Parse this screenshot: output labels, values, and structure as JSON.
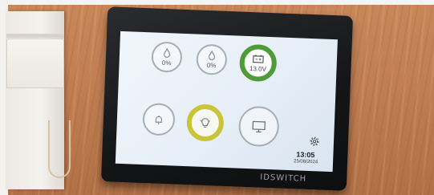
{
  "device": {
    "brand": "IDSWITCH",
    "tiles": [
      {
        "id": "water-tank-1",
        "icon": "droplet-icon",
        "value": "0%"
      },
      {
        "id": "water-tank-2",
        "icon": "droplet-icon",
        "value": "0%"
      },
      {
        "id": "battery",
        "icon": "battery-icon",
        "value": "13.0V",
        "ring_color": "#4f9b3a"
      },
      {
        "id": "alarm",
        "icon": "bell-icon",
        "value": ""
      },
      {
        "id": "lights",
        "icon": "lightbulb-icon",
        "value": "",
        "ring_color": "#c9c438"
      },
      {
        "id": "tv",
        "icon": "monitor-icon",
        "value": ""
      }
    ],
    "clock": {
      "time": "13:05",
      "date": "25/08/2024"
    },
    "settings_icon": "gear-icon"
  }
}
